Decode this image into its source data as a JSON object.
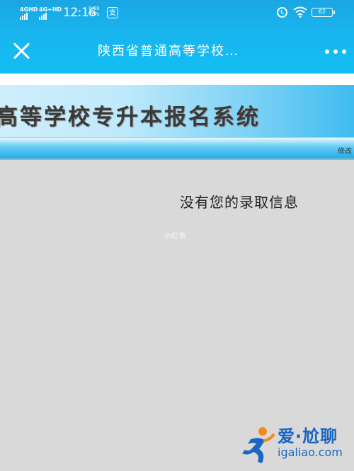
{
  "status_bar": {
    "net1": "4GHD",
    "net2": "4G+HD",
    "time": "12:16",
    "speed_top": "0.60",
    "speed_unit": "KB/s",
    "app_icon": "支",
    "battery": "62"
  },
  "title_bar": {
    "title": "陕西省普通高等学校…"
  },
  "page": {
    "banner_title": "高等学校专升本报名系统",
    "modify_link": "修改",
    "message": "没有您的录取信息",
    "watermark": "小红书"
  },
  "logo": {
    "cn": "爱·尬聊",
    "en": "igaliao.com"
  },
  "colors": {
    "topbar": "#13bff4",
    "page_bg": "#d9d9d9",
    "logo_blue": "#1a66c2",
    "logo_orange": "#f08a1c"
  }
}
